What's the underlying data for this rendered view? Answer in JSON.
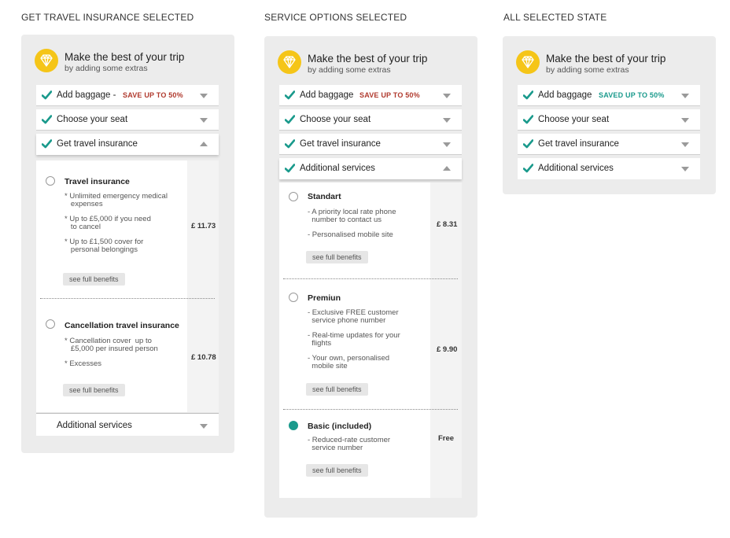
{
  "colors": {
    "accent": "#1a9a8c",
    "save_red": "#b03a2e",
    "badge": "#f5c518",
    "panel": "#ececec"
  },
  "columns": [
    {
      "title": "GET TRAVEL INSURANCE SELECTED"
    },
    {
      "title": "SERVICE OPTIONS SELECTED"
    },
    {
      "title": "ALL SELECTED STATE"
    }
  ],
  "header": {
    "icon": "diamond-icon",
    "title": "Make the best of your trip",
    "subtitle": "by adding some extras"
  },
  "panel1": {
    "rows": {
      "baggage": {
        "label": "Add baggage -",
        "save": "SAVE UP TO 50%"
      },
      "seat": {
        "label": "Choose your seat"
      },
      "insurance": {
        "label": "Get travel insurance"
      },
      "additional": {
        "label": "Additional services"
      }
    },
    "options": [
      {
        "name": "Travel insurance",
        "bullets": [
          "* Unlimited emergency medical\n   expenses",
          "* Up to £5,000 if you need\n   to cancel",
          "* Up to £1,500 cover for\n   personal belongings"
        ],
        "benefits": "see full benefits",
        "price": "£ 11.73"
      },
      {
        "name": "Cancellation travel insurance",
        "bullets": [
          "* Cancellation cover  up to\n   £5,000 per insured person",
          "* Excesses"
        ],
        "benefits": "see full benefits",
        "price": "£ 10.78"
      }
    ]
  },
  "panel2": {
    "rows": {
      "baggage": {
        "label": "Add baggage",
        "save": "SAVE UP TO 50%"
      },
      "seat": {
        "label": "Choose your seat"
      },
      "insurance": {
        "label": "Get travel insurance"
      },
      "additional": {
        "label": "Additional services"
      }
    },
    "options": [
      {
        "name": "Standart",
        "bullets": [
          "- A priority local rate phone\n  number to contact us",
          "- Personalised mobile site"
        ],
        "benefits": "see full benefits",
        "price": "£ 8.31"
      },
      {
        "name": "Premiun",
        "bullets": [
          "- Exclusive FREE customer\n  service phone number",
          "- Real-time updates for your\n  flights",
          "- Your own, personalised\n  mobile site"
        ],
        "benefits": "see full benefits",
        "price": "£ 9.90"
      },
      {
        "name": "Basic (included)",
        "bullets": [
          "- Reduced-rate customer\n  service number"
        ],
        "benefits": "see full benefits",
        "price": "Free"
      }
    ]
  },
  "panel3": {
    "rows": {
      "baggage": {
        "label": "Add baggage",
        "save": "SAVED UP TO 50%"
      },
      "seat": {
        "label": "Choose your seat"
      },
      "insurance": {
        "label": "Get travel insurance"
      },
      "additional": {
        "label": "Additional services"
      }
    }
  }
}
